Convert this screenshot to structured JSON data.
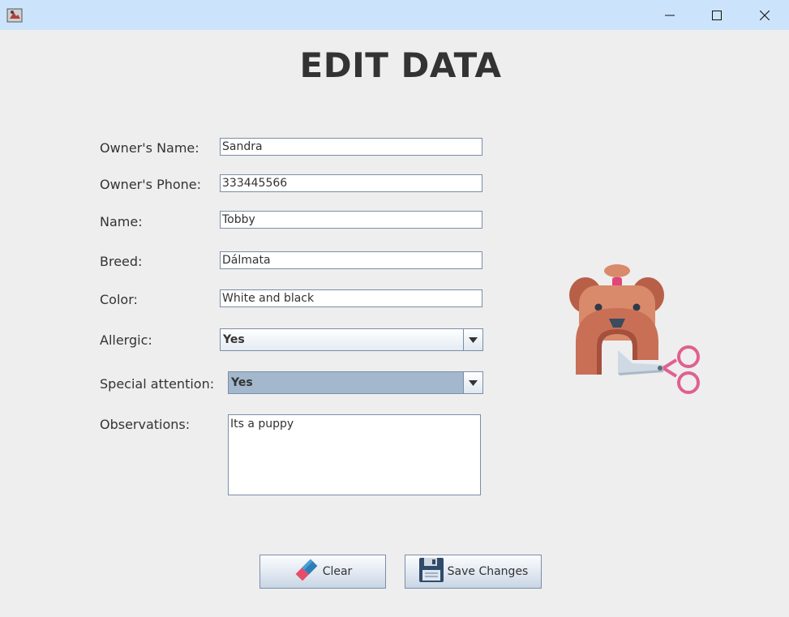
{
  "window": {
    "minimize_symbol": "—",
    "maximize_symbol": "☐",
    "close_symbol": "✕"
  },
  "page": {
    "title": "EDIT DATA"
  },
  "form": {
    "owner_name": {
      "label": "Owner's Name:",
      "value": "Sandra"
    },
    "owner_phone": {
      "label": "Owner's Phone:",
      "value": "333445566"
    },
    "name": {
      "label": "Name:",
      "value": "Tobby"
    },
    "breed": {
      "label": "Breed:",
      "value": "Dálmata"
    },
    "color": {
      "label": "Color:",
      "value": "White and black"
    },
    "allergic": {
      "label": "Allergic:",
      "selected": "Yes"
    },
    "special_attention": {
      "label": "Special attention:",
      "selected": "Yes"
    },
    "observations": {
      "label": "Observations:",
      "value": "Its a puppy"
    }
  },
  "buttons": {
    "clear": {
      "label": "Clear",
      "icon": "eraser-icon"
    },
    "save": {
      "label": "Save Changes",
      "icon": "floppy-disk-icon"
    }
  },
  "colors": {
    "titlebar": "#cce4fb",
    "background": "#eeeeee",
    "combo_focused": "#a3b8cc",
    "illustration_dog": "#c96f55",
    "illustration_scissors": "#e06090"
  }
}
